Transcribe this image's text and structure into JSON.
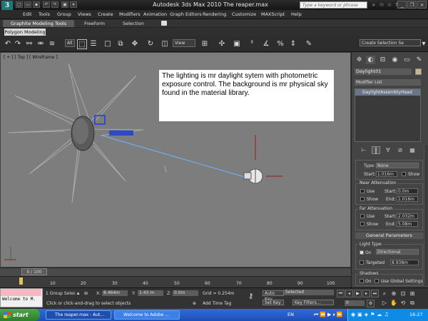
{
  "titlebar": {
    "app_title": "Autodesk 3ds Max  2010      The reaper.max",
    "search_placeholder": "Type a keyword or phrase"
  },
  "menu": [
    "Edit",
    "Tools",
    "Group",
    "Views",
    "Create",
    "Modifiers",
    "Animation",
    "Graph Editors",
    "Rendering",
    "Customize",
    "MAXScript",
    "Help"
  ],
  "ribbon": {
    "tabs": [
      "Graphite Modeling Tools",
      "Freeform",
      "Selection"
    ],
    "sub_tab": "Polygon Modeling"
  },
  "toolbar": {
    "filter": "All",
    "ref_coord": "View",
    "selection_set": "Create Selection Se"
  },
  "viewport": {
    "label": "[ + ] [ Top ] [ Wireframe ]",
    "note": "The lighting is mr daylight sytem with photometric exposure control.  The background is mr physical sky found in the material library."
  },
  "command_panel": {
    "object_name": "Daylight01",
    "modifier_list": "Modifier List",
    "stack_item": "DaylightAssemblyHead",
    "decay": {
      "type_label": "Type:",
      "type_value": "None",
      "start_label": "Start:",
      "start_value": "1.016m",
      "show_label": "Show"
    },
    "near_attenuation": {
      "title": "Near Attenuation",
      "use_label": "Use",
      "show_label": "Show",
      "start_label": "Start:",
      "start_value": "0.0m",
      "end_label": "End:",
      "end_value": "1.016m"
    },
    "far_attenuation": {
      "title": "Far Attenuation",
      "use_label": "Use",
      "show_label": "Show",
      "start_label": "Start:",
      "start_value": "2.032m",
      "end_label": "End:",
      "end_value": "5.08m"
    },
    "general": {
      "title": "General Parameters",
      "light_type_label": "Light Type",
      "on_label": "On",
      "light_type_value": "Directional",
      "targeted_label": "Targeted",
      "targeted_value": "8.938m",
      "shadows_label": "Shadows",
      "use_global_label": "Use Global Settings"
    }
  },
  "timeline": {
    "frame": "0 / 100",
    "ticks": [
      "10",
      "20",
      "30",
      "40",
      "50",
      "60",
      "70",
      "80",
      "90",
      "100"
    ]
  },
  "status": {
    "welcome": "Welcome to M.",
    "selection": "1 Group Selec",
    "prompt": "Click or click-and-drag to select objects",
    "x_label": "X:",
    "x_value": "8.464m",
    "y_label": "Y:",
    "y_value": "1.43 m",
    "z_label": "Z:",
    "z_value": "0.0m",
    "grid": "Grid = 0.254m",
    "add_time_tag": "Add Time Tag",
    "auto_key": "Auto Key",
    "set_key": "Set Key",
    "selected": "Selected",
    "key_filters": "Key Filters...",
    "frame_field": "0"
  },
  "taskbar": {
    "start": "start",
    "task1": "The reaper.max - Aut...",
    "task2": "Welcome to Adobe ...",
    "lang": "EN",
    "clock": "16:27"
  },
  "colors": {
    "viewport_bg": "#7d7d7d",
    "light_beam": "#6fb3ff",
    "selection_blue": "#1b3fd6"
  }
}
